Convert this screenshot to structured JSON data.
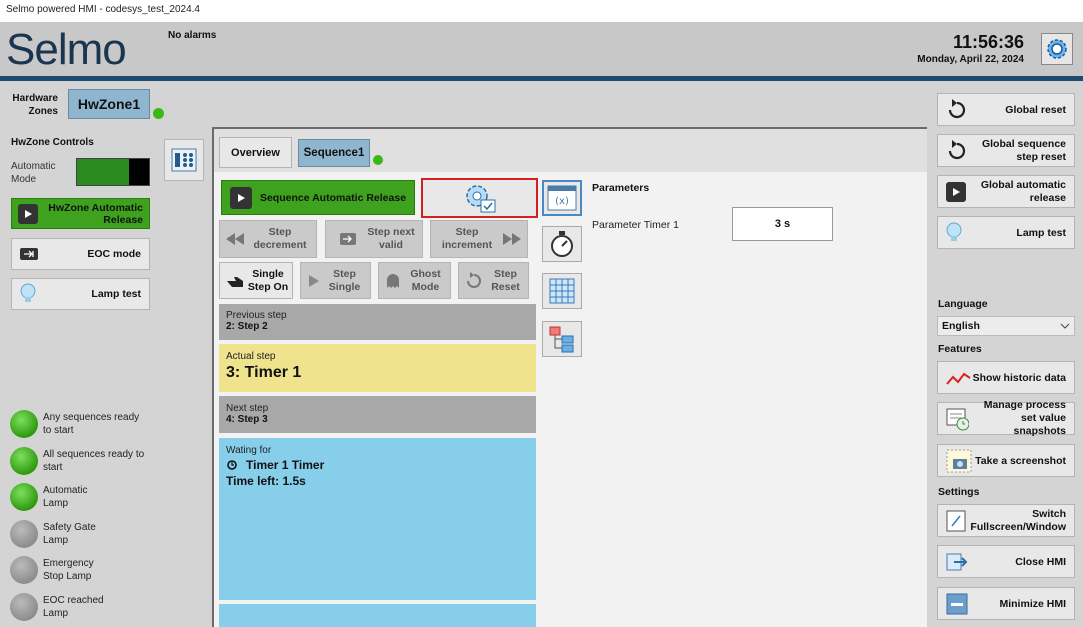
{
  "window": {
    "title": "Selmo powered HMI - codesys_test_2024.4"
  },
  "header": {
    "logo": "Selmo",
    "alarm_status": "No alarms",
    "time": "11:56:36",
    "date": "Monday, April 22, 2024",
    "settings_icon": "gear-icon"
  },
  "left": {
    "hw_zones_label": "Hardware Zones",
    "hw_zone_button": "HwZone1",
    "controls_title": "HwZone Controls",
    "automatic_mode_label": "Automatic Mode",
    "release_button": "HwZone Automatic Release",
    "eoc_button": "EOC mode",
    "lamp_test_button": "Lamp test",
    "lamps": [
      {
        "label": "Any sequences ready to start",
        "state": "green"
      },
      {
        "label": "All sequences ready to start",
        "state": "green"
      },
      {
        "label": "Automatic Lamp",
        "state": "green"
      },
      {
        "label": "Safety Gate Lamp",
        "state": "gray"
      },
      {
        "label": "Emergency Stop Lamp",
        "state": "gray"
      },
      {
        "label": "EOC reached Lamp",
        "state": "gray"
      }
    ]
  },
  "tabs": {
    "overview": "Overview",
    "sequence": "Sequence1"
  },
  "sequence": {
    "auto_release": "Sequence Automatic Release",
    "step_decrement": "Step decrement",
    "step_next_valid": "Step next valid",
    "step_increment": "Step increment",
    "single_step_on": "Single Step On",
    "step_single": "Step Single",
    "ghost_mode": "Ghost Mode",
    "step_reset": "Step Reset",
    "previous_label": "Previous step",
    "previous_value": "2: Step 2",
    "actual_label": "Actual step",
    "actual_value": "3: Timer 1",
    "next_label": "Next step",
    "next_value": "4: Step 3",
    "waiting_label": "Wating for",
    "waiting_item": "Timer 1 Timer",
    "time_left": "Time left: 1.5s"
  },
  "parameters": {
    "title": "Parameters",
    "name": "Parameter Timer 1",
    "value": "3 s"
  },
  "right": {
    "global_reset": "Global reset",
    "global_seq_step_reset": "Global sequence step reset",
    "global_auto_release": "Global automatic release",
    "lamp_test": "Lamp test",
    "language_label": "Language",
    "language_value": "English",
    "features_label": "Features",
    "show_historic": "Show historic data",
    "manage_snapshots": "Manage process set value snapshots",
    "screenshot": "Take a screenshot",
    "settings_label": "Settings",
    "switch_fullscreen": "Switch Fullscreen/Window",
    "close_hmi": "Close HMI",
    "minimize_hmi": "Minimize HMI"
  },
  "colors": {
    "accent": "#1e4a6e",
    "green": "#3ea21e",
    "actual_step": "#efe38d",
    "waiting": "#87ceeb",
    "highlight": "#d32020"
  }
}
